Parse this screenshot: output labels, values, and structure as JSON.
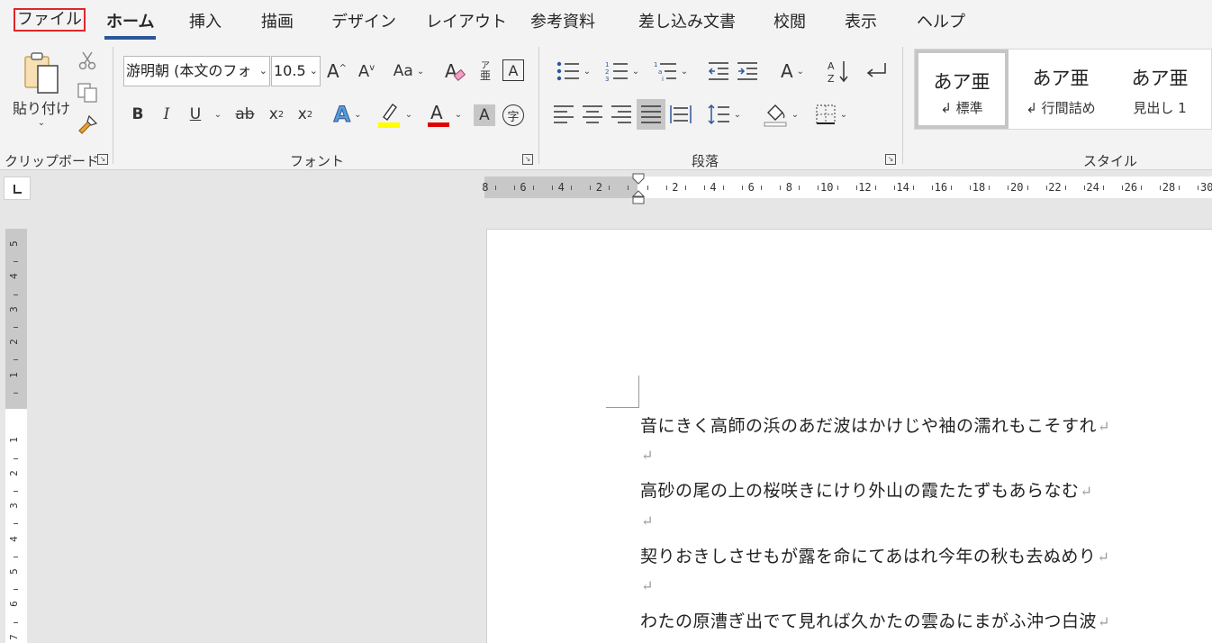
{
  "tabs": [
    "ファイル",
    "ホーム",
    "挿入",
    "描画",
    "デザイン",
    "レイアウト",
    "参考資料",
    "差し込み文書",
    "校閲",
    "表示",
    "ヘルプ"
  ],
  "clipboard": {
    "paste_label": "貼り付け",
    "group_label": "クリップボード"
  },
  "font": {
    "font_name": "游明朝 (本文のフォ",
    "font_size": "10.5",
    "change_case": "Aa",
    "bold": "B",
    "italic": "I",
    "underline": "U",
    "strike": "ab",
    "subscript": "x",
    "superscript": "x",
    "group_label": "フォント",
    "phonetic": "亜",
    "enclose_char": "字"
  },
  "paragraph": {
    "group_label": "段落"
  },
  "styles": {
    "group_label": "スタイル",
    "preview_text": "あア亜",
    "items": [
      "↲ 標準",
      "↲ 行間詰め",
      "見出し 1"
    ]
  },
  "ruler": {
    "h_numbers": [
      "8",
      "6",
      "4",
      "2",
      "2",
      "4",
      "6",
      "8",
      "10",
      "12",
      "14",
      "16",
      "18",
      "20",
      "22",
      "24",
      "26",
      "28",
      "30"
    ],
    "v_numbers": [
      "5",
      "4",
      "3",
      "2",
      "1",
      "1",
      "2",
      "3",
      "4",
      "5",
      "6",
      "7"
    ]
  },
  "document": {
    "paragraphs": [
      "音にきく高師の浜のあだ波はかけじや袖の濡れもこそすれ",
      "",
      "高砂の尾の上の桜咲きにけり外山の霞たたずもあらなむ",
      "",
      "契りおきしさせもが露を命にてあはれ今年の秋も去ぬめり",
      "",
      "わたの原漕ぎ出でて見れば久かたの雲ゐにまがふ沖つ白波"
    ],
    "paragraph_mark": "↵"
  },
  "colors": {
    "accent": "#2b579a",
    "file_border": "#e0252b",
    "highlight": "#ffff00",
    "font_color": "#ff0000"
  }
}
